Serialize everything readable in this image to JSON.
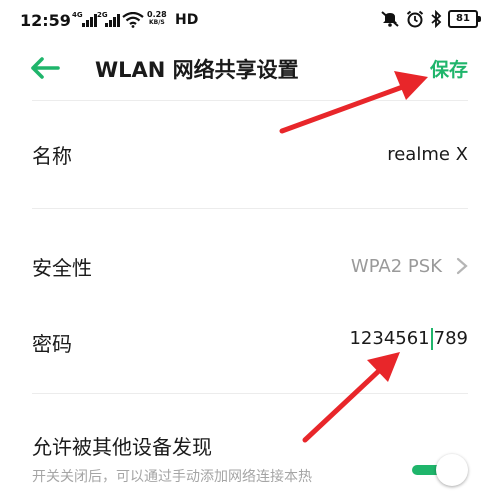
{
  "status_bar": {
    "time": "12:59",
    "sim1_type": "4G",
    "sim2_type": "2G",
    "speed_value": "0.28",
    "speed_unit": "KB/S",
    "hd_label": "HD",
    "battery_level": "81"
  },
  "header": {
    "title": "WLAN 网络共享设置",
    "save_label": "保存"
  },
  "settings": {
    "name_label": "名称",
    "name_value": "realme X",
    "security_label": "安全性",
    "security_value": "WPA2 PSK",
    "password_label": "密码",
    "password_before_cursor": "1234561",
    "password_after_cursor": "789",
    "discoverable_label": "允许被其他设备发现",
    "discoverable_hint": "开关关闭后，可以通过手动添加网络连接本热",
    "discoverable_enabled": true
  },
  "colors": {
    "accent": "#1fb56b",
    "annotation_arrow": "#e8262a",
    "muted_text": "#9a9a9a"
  }
}
